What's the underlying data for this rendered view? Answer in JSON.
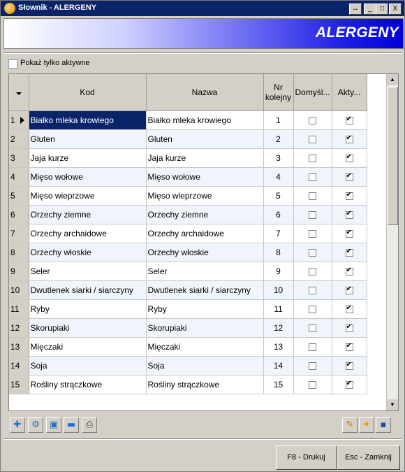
{
  "window": {
    "title": "Słownik - ALERGENY",
    "controls": [
      "↔",
      "_",
      "□",
      "X"
    ]
  },
  "banner": {
    "title": "ALERGENY"
  },
  "filter": {
    "label": "Pokaż tylko aktywne",
    "checked": false
  },
  "grid": {
    "columns": [
      "Kod",
      "Nazwa",
      "Nr kolejny",
      "Domyśl...",
      "Akty..."
    ],
    "rows": [
      {
        "n": "1",
        "kod": "Białko mleka krowiego",
        "nazwa": "Białko mleka krowiego",
        "nr": "1",
        "domyslny": false,
        "aktywny": true
      },
      {
        "n": "2",
        "kod": "Gluten",
        "nazwa": "Gluten",
        "nr": "2",
        "domyslny": false,
        "aktywny": true
      },
      {
        "n": "3",
        "kod": "Jaja kurze",
        "nazwa": "Jaja kurze",
        "nr": "3",
        "domyslny": false,
        "aktywny": true
      },
      {
        "n": "4",
        "kod": "Mięso wołowe",
        "nazwa": "Mięso wołowe",
        "nr": "4",
        "domyslny": false,
        "aktywny": true
      },
      {
        "n": "5",
        "kod": "Mięso wieprzowe",
        "nazwa": "Mięso wieprzowe",
        "nr": "5",
        "domyslny": false,
        "aktywny": true
      },
      {
        "n": "6",
        "kod": "Orzechy ziemne",
        "nazwa": "Orzechy ziemne",
        "nr": "6",
        "domyslny": false,
        "aktywny": true
      },
      {
        "n": "7",
        "kod": "Orzechy archaidowe",
        "nazwa": "Orzechy archaidowe",
        "nr": "7",
        "domyslny": false,
        "aktywny": true
      },
      {
        "n": "8",
        "kod": "Orzechy włoskie",
        "nazwa": "Orzechy włoskie",
        "nr": "8",
        "domyslny": false,
        "aktywny": true
      },
      {
        "n": "9",
        "kod": "Seler",
        "nazwa": "Seler",
        "nr": "9",
        "domyslny": false,
        "aktywny": true
      },
      {
        "n": "10",
        "kod": "Dwutlenek siarki / siarczyny",
        "nazwa": "Dwutlenek siarki / siarczyny",
        "nr": "10",
        "domyslny": false,
        "aktywny": true
      },
      {
        "n": "11",
        "kod": "Ryby",
        "nazwa": "Ryby",
        "nr": "11",
        "domyslny": false,
        "aktywny": true
      },
      {
        "n": "12",
        "kod": "Skorupiaki",
        "nazwa": "Skorupiaki",
        "nr": "12",
        "domyslny": false,
        "aktywny": true
      },
      {
        "n": "13",
        "kod": "Mięczaki",
        "nazwa": "Mięczaki",
        "nr": "13",
        "domyslny": false,
        "aktywny": true
      },
      {
        "n": "14",
        "kod": "Soja",
        "nazwa": "Soja",
        "nr": "14",
        "domyslny": false,
        "aktywny": true
      },
      {
        "n": "15",
        "kod": "Rośliny strączkowe",
        "nazwa": "Rośliny strączkowe",
        "nr": "15",
        "domyslny": false,
        "aktywny": true
      }
    ]
  },
  "toolbar": {
    "left_icons": [
      "add-icon",
      "settings-icon",
      "preview-icon",
      "remove-icon",
      "print-icon"
    ],
    "right_icons": [
      "edit-icon",
      "new-icon",
      "save-icon"
    ]
  },
  "buttons": {
    "print": "F8 - Drukuj",
    "close": "Esc - Zamknij"
  },
  "colors": {
    "title_bar": "#0a246a",
    "selection": "#0a246a",
    "banner_end": "#0000d8"
  }
}
